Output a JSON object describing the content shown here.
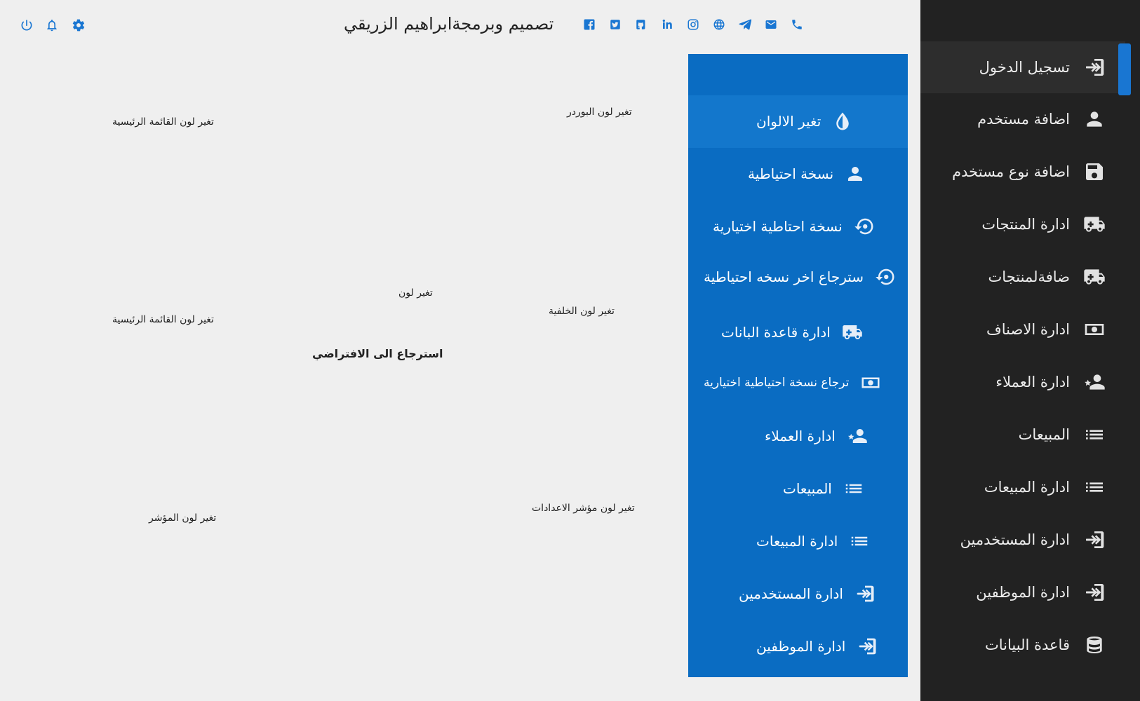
{
  "header": {
    "title": "تصميم وبرمجةابراهيم الزريقي",
    "social_icons": [
      "facebook-icon",
      "twitter-icon",
      "github-icon",
      "linkedin-icon",
      "instagram-icon",
      "globe-icon",
      "telegram-icon",
      "email-icon",
      "phone-icon"
    ],
    "tool_icons": [
      "power-icon",
      "bell-icon",
      "gear-icon"
    ]
  },
  "sidebar": {
    "items": [
      {
        "label": "تسجيل الدخول",
        "icon": "login-icon",
        "active": true
      },
      {
        "label": "اضافة مستخدم",
        "icon": "user-icon"
      },
      {
        "label": "اضافة نوع مستخدم",
        "icon": "save-icon"
      },
      {
        "label": "ادارة المنتجات",
        "icon": "truck-icon"
      },
      {
        "label": "ضافةلمنتجات",
        "icon": "truck-icon"
      },
      {
        "label": "ادارة الاصناف",
        "icon": "money-icon"
      },
      {
        "label": "ادارة العملاء",
        "icon": "user-star-icon"
      },
      {
        "label": "المبيعات",
        "icon": "list-icon"
      },
      {
        "label": "ادارة المبيعات",
        "icon": "list-icon"
      },
      {
        "label": "ادارة المستخدمين",
        "icon": "login-icon"
      },
      {
        "label": "ادارة الموظفين",
        "icon": "login-icon"
      },
      {
        "label": "قاعدة البيانات",
        "icon": "database-icon"
      }
    ]
  },
  "submenu": {
    "items": [
      {
        "label": "تغير الالوان",
        "icon": "drop-icon",
        "active": true
      },
      {
        "label": "نسخة احتياطية",
        "icon": "user-icon"
      },
      {
        "label": "نسخة احتاطية اختيارية",
        "icon": "restore-icon"
      },
      {
        "label": "سترجاع اخر نسخه احتياطية",
        "icon": "restore-icon"
      },
      {
        "label": "ادارة قاعدة البانات",
        "icon": "truck-icon"
      },
      {
        "label": "ترجاع  نسخة احتياطية اختيارية",
        "icon": "money-icon"
      },
      {
        "label": "ادارة العملاء",
        "icon": "user-star-icon"
      },
      {
        "label": "المبيعات",
        "icon": "list-icon"
      },
      {
        "label": "ادارة المبيعات",
        "icon": "list-icon"
      },
      {
        "label": "ادارة المستخدمين",
        "icon": "login-icon"
      },
      {
        "label": "ادارة الموظفين",
        "icon": "login-icon"
      }
    ]
  },
  "settings": {
    "border_color": "تغير لون البوردر",
    "main_menu_color_1": "تغير لون القائمة الرئيسية",
    "color": "تغير لون",
    "background_color": "تغير لون الخلفية",
    "main_menu_color_2": "تغير لون القائمة الرئيسية",
    "reset_default": "استرجاع الى الافتراضي",
    "settings_indicator_color": "تغير لون مؤشر الاعدادات",
    "cursor_color": "تغير لون المؤشر"
  },
  "colors": {
    "sidebar_bg": "#222222",
    "panel_blue": "#0a6cc2",
    "accent": "#1976d2",
    "page_bg": "#efefef"
  }
}
